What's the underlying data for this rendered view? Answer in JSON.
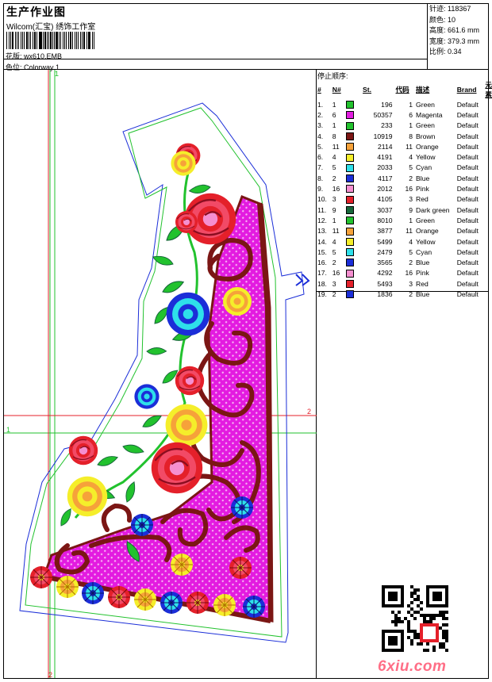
{
  "header": {
    "title": "生产作业图",
    "company": "Wilcom(汇宝) 绣饰工作室",
    "design_label": "花版:",
    "design_value": "wx610.EMB",
    "colorway_label": "色位:",
    "colorway_value": "Colorway 1"
  },
  "stats": {
    "stitches_label": "针迹:",
    "stitches_value": "118367",
    "colors_label": "颜色:",
    "colors_value": "10",
    "height_label": "高度:",
    "height_value": "661.6 mm",
    "width_label": "宽度:",
    "width_value": "379.3 mm",
    "scale_label": "比例:",
    "scale_value": "0.34"
  },
  "stop_sequence": {
    "title": "停止顺序:",
    "headers": [
      "#",
      "N#",
      "St.",
      "代码",
      "描述",
      "Brand",
      "元素"
    ],
    "rows": [
      {
        "idx": "1.",
        "n": "1",
        "color": "#22c22e",
        "st": "196",
        "code": "1",
        "desc": "Green",
        "brand": "Default"
      },
      {
        "idx": "2.",
        "n": "6",
        "color": "#e21ce0",
        "st": "50357",
        "code": "6",
        "desc": "Magenta",
        "brand": "Default"
      },
      {
        "idx": "3.",
        "n": "1",
        "color": "#22c22e",
        "st": "233",
        "code": "1",
        "desc": "Green",
        "brand": "Default"
      },
      {
        "idx": "4.",
        "n": "8",
        "color": "#7b1614",
        "st": "10919",
        "code": "8",
        "desc": "Brown",
        "brand": "Default"
      },
      {
        "idx": "5.",
        "n": "11",
        "color": "#f6a23a",
        "st": "2114",
        "code": "11",
        "desc": "Orange",
        "brand": "Default"
      },
      {
        "idx": "6.",
        "n": "4",
        "color": "#f5ee2a",
        "st": "4191",
        "code": "4",
        "desc": "Yellow",
        "brand": "Default"
      },
      {
        "idx": "7.",
        "n": "5",
        "color": "#2ee0ea",
        "st": "2033",
        "code": "5",
        "desc": "Cyan",
        "brand": "Default"
      },
      {
        "idx": "8.",
        "n": "2",
        "color": "#1b2ed8",
        "st": "4117",
        "code": "2",
        "desc": "Blue",
        "brand": "Default"
      },
      {
        "idx": "9.",
        "n": "16",
        "color": "#f58fd0",
        "st": "2012",
        "code": "16",
        "desc": "Pink",
        "brand": "Default"
      },
      {
        "idx": "10.",
        "n": "3",
        "color": "#e4202a",
        "st": "4105",
        "code": "3",
        "desc": "Red",
        "brand": "Default"
      },
      {
        "idx": "11.",
        "n": "9",
        "color": "#17663a",
        "st": "3037",
        "code": "9",
        "desc": "Dark green",
        "brand": "Default"
      },
      {
        "idx": "12.",
        "n": "1",
        "color": "#22c22e",
        "st": "8010",
        "code": "1",
        "desc": "Green",
        "brand": "Default"
      },
      {
        "idx": "13.",
        "n": "11",
        "color": "#f6a23a",
        "st": "3877",
        "code": "11",
        "desc": "Orange",
        "brand": "Default"
      },
      {
        "idx": "14.",
        "n": "4",
        "color": "#f5ee2a",
        "st": "5499",
        "code": "4",
        "desc": "Yellow",
        "brand": "Default"
      },
      {
        "idx": "15.",
        "n": "5",
        "color": "#2ee0ea",
        "st": "2479",
        "code": "5",
        "desc": "Cyan",
        "brand": "Default"
      },
      {
        "idx": "16.",
        "n": "2",
        "color": "#1b2ed8",
        "st": "3565",
        "code": "2",
        "desc": "Blue",
        "brand": "Default"
      },
      {
        "idx": "17.",
        "n": "16",
        "color": "#f58fd0",
        "st": "4292",
        "code": "16",
        "desc": "Pink",
        "brand": "Default"
      },
      {
        "idx": "18.",
        "n": "3",
        "color": "#e4202a",
        "st": "5493",
        "code": "3",
        "desc": "Red",
        "brand": "Default"
      },
      {
        "idx": "19.",
        "n": "2",
        "color": "#1b2ed8",
        "st": "1836",
        "code": "2",
        "desc": "Blue",
        "brand": "Default"
      }
    ]
  },
  "drawing": {
    "marker_1": "1",
    "marker_2": "2"
  },
  "watermark": "6xiu.com"
}
